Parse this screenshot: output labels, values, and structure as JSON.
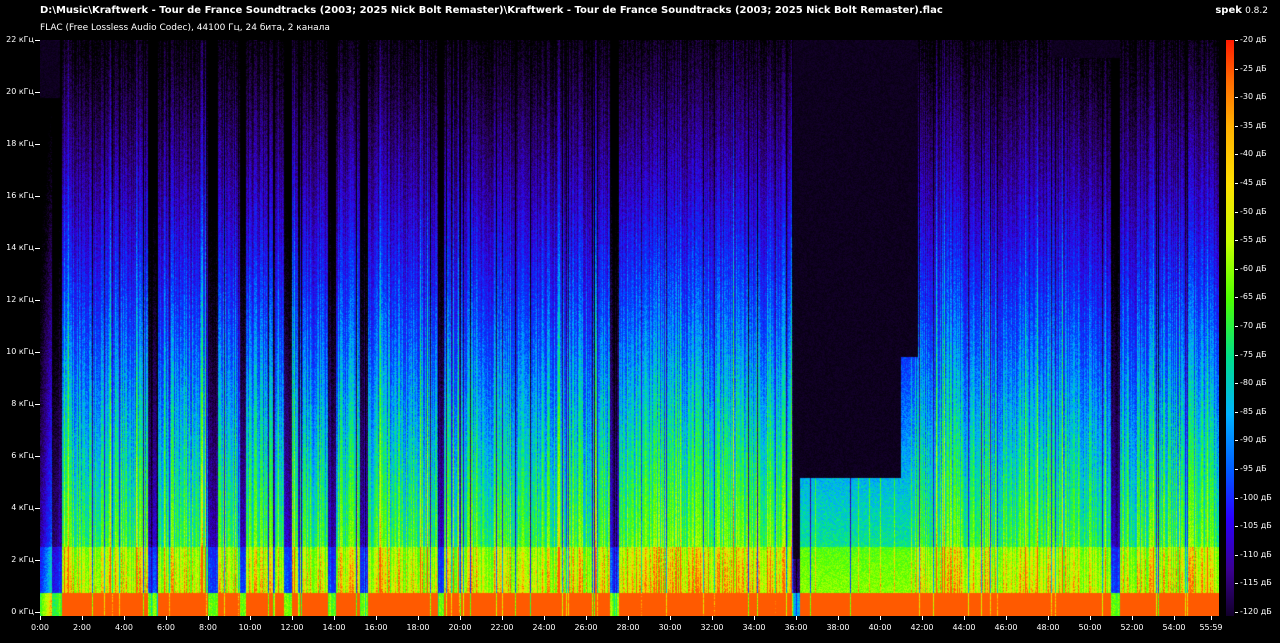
{
  "header": {
    "file_path": "D:\\Music\\Kraftwerk - Tour de France Soundtracks (2003; 2025 Nick Bolt Remaster)\\Kraftwerk - Tour de France Soundtracks (2003; 2025 Nick Bolt Remaster).flac",
    "file_info": "FLAC (Free Lossless Audio Codec), 44100 Гц, 24 бита, 2 канала"
  },
  "brand": {
    "name": "spek",
    "version": "0.8.2"
  },
  "freq_axis": [
    "22 кГц",
    "20 кГц",
    "18 кГц",
    "16 кГц",
    "14 кГц",
    "12 кГц",
    "10 кГц",
    "8 кГц",
    "6 кГц",
    "4 кГц",
    "2 кГц",
    "0 кГц"
  ],
  "time_axis": [
    "0:00",
    "2:00",
    "4:00",
    "6:00",
    "8:00",
    "10:00",
    "12:00",
    "14:00",
    "16:00",
    "18:00",
    "20:00",
    "22:00",
    "24:00",
    "26:00",
    "28:00",
    "30:00",
    "32:00",
    "34:00",
    "36:00",
    "38:00",
    "40:00",
    "42:00",
    "44:00",
    "46:00",
    "48:00",
    "50:00",
    "52:00",
    "54:00",
    "55:59"
  ],
  "db_scale": [
    "-20 дБ",
    "-25 дБ",
    "-30 дБ",
    "-35 дБ",
    "-40 дБ",
    "-45 дБ",
    "-50 дБ",
    "-55 дБ",
    "-60 дБ",
    "-65 дБ",
    "-70 дБ",
    "-75 дБ",
    "-80 дБ",
    "-85 дБ",
    "-90 дБ",
    "-95 дБ",
    "-100 дБ",
    "-105 дБ",
    "-110 дБ",
    "-115 дБ",
    "-120 дБ"
  ]
}
